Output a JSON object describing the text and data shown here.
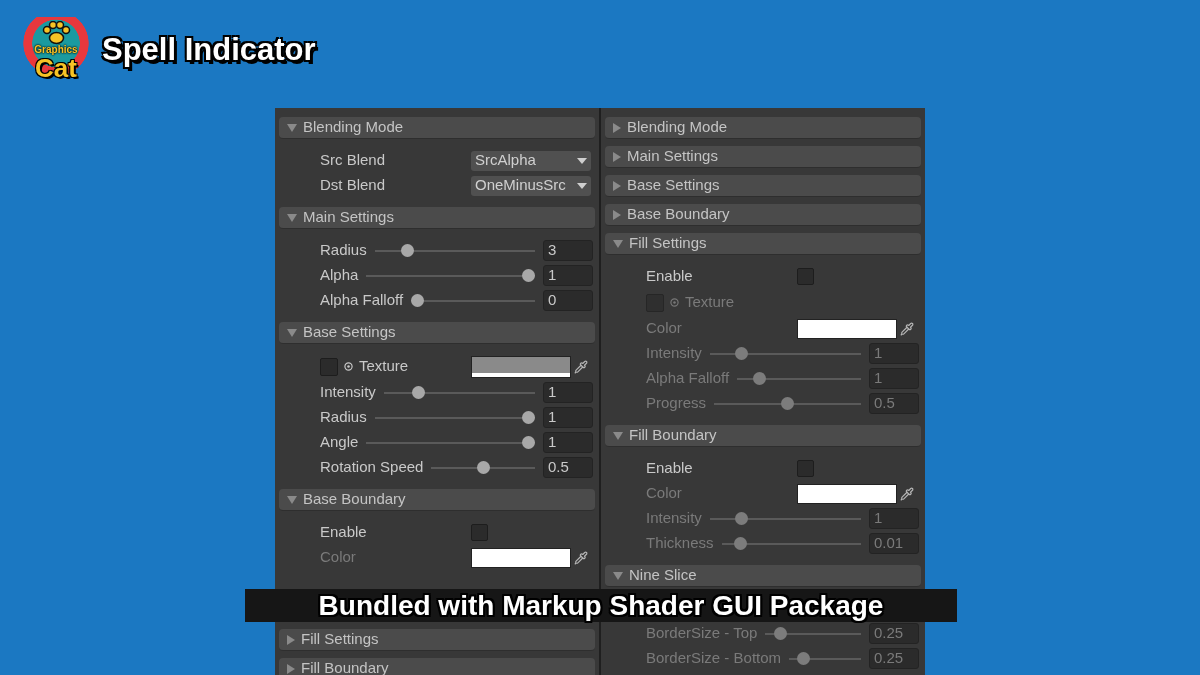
{
  "logo": {
    "line_1": "Graphics",
    "line_2": "Cat"
  },
  "title": "Spell Indicator",
  "columns": [
    {
      "sections": [
        {
          "title": "Blending Mode",
          "expanded": true,
          "rows": [
            {
              "kind": "dropdown",
              "label": "Src Blend",
              "value": "SrcAlpha",
              "disabled": false
            },
            {
              "kind": "dropdown",
              "label": "Dst Blend",
              "value": "OneMinusSrc",
              "disabled": false
            }
          ]
        },
        {
          "title": "Main Settings",
          "expanded": true,
          "rows": [
            {
              "kind": "slider",
              "label": "Radius",
              "level": 0.18,
              "value": "3",
              "disabled": false
            },
            {
              "kind": "slider",
              "label": "Alpha",
              "level": 1,
              "value": "1",
              "disabled": false
            },
            {
              "kind": "slider",
              "label": "Alpha Falloff",
              "level": 0,
              "value": "0",
              "disabled": false
            }
          ]
        },
        {
          "title": "Base Settings",
          "expanded": true,
          "rows": [
            {
              "kind": "texture",
              "label": "Texture",
              "checked": false,
              "disabled": false
            },
            {
              "kind": "slider",
              "label": "Intensity",
              "level": 0.2,
              "value": "1",
              "disabled": false
            },
            {
              "kind": "slider",
              "label": "Radius",
              "level": 1,
              "value": "1",
              "disabled": false
            },
            {
              "kind": "slider",
              "label": "Angle",
              "level": 1,
              "value": "1",
              "disabled": false
            },
            {
              "kind": "slider",
              "label": "Rotation Speed",
              "level": 0.5,
              "value": "0.5",
              "disabled": false
            }
          ]
        },
        {
          "title": "Base Boundary",
          "expanded": true,
          "rows": [
            {
              "kind": "toggle",
              "label": "Enable",
              "checked": false,
              "disabled": false
            },
            {
              "kind": "color",
              "label": "Color",
              "color": "#ffffff",
              "disabled": true
            }
          ]
        },
        {
          "title": "Fill Settings",
          "expanded": false
        },
        {
          "title": "Fill Boundary",
          "expanded": false
        }
      ]
    },
    {
      "sections": [
        {
          "title": "Blending Mode",
          "expanded": false
        },
        {
          "title": "Main Settings",
          "expanded": false
        },
        {
          "title": "Base Settings",
          "expanded": false
        },
        {
          "title": "Base Boundary",
          "expanded": false
        },
        {
          "title": "Fill Settings",
          "expanded": true,
          "rows": [
            {
              "kind": "toggle",
              "label": "Enable",
              "checked": false,
              "disabled": false
            },
            {
              "kind": "texture",
              "label": "Texture",
              "checked": false,
              "disabled": true
            },
            {
              "kind": "color",
              "label": "Color",
              "color": "#ffffff",
              "disabled": true
            },
            {
              "kind": "slider",
              "label": "Intensity",
              "level": 0.18,
              "value": "1",
              "disabled": true
            },
            {
              "kind": "slider",
              "label": "Alpha Falloff",
              "level": 0.14,
              "value": "1",
              "disabled": true
            },
            {
              "kind": "slider",
              "label": "Progress",
              "level": 0.5,
              "value": "0.5",
              "disabled": true
            }
          ]
        },
        {
          "title": "Fill Boundary",
          "expanded": true,
          "rows": [
            {
              "kind": "toggle",
              "label": "Enable",
              "checked": false,
              "disabled": false
            },
            {
              "kind": "color",
              "label": "Color",
              "color": "#ffffff",
              "disabled": true
            },
            {
              "kind": "slider",
              "label": "Intensity",
              "level": 0.18,
              "value": "1",
              "disabled": true
            },
            {
              "kind": "slider",
              "label": "Thickness",
              "level": 0.1,
              "value": "0.01",
              "disabled": true
            }
          ]
        },
        {
          "title": "Nine Slice",
          "expanded": true,
          "rows": [
            {
              "kind": "slider",
              "label": "BorderSize - Top",
              "level": 0.1,
              "value": "0.25",
              "disabled": true
            },
            {
              "kind": "slider",
              "label": "BorderSize - Bottom",
              "level": 0.14,
              "value": "0.25",
              "disabled": true
            }
          ]
        }
      ]
    }
  ],
  "caption": "Bundled with Markup Shader GUI Package"
}
